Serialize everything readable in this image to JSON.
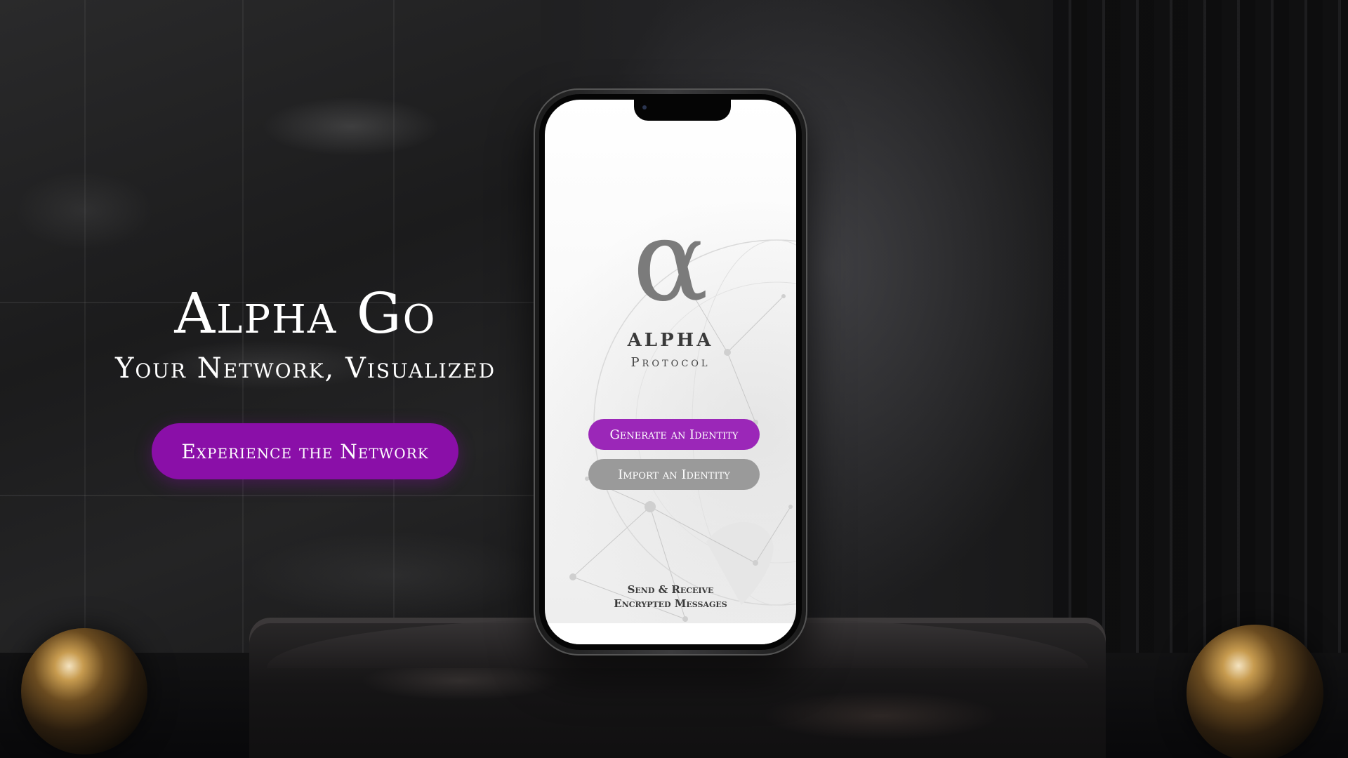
{
  "hero": {
    "title": "Alpha Go",
    "subtitle": "Your Network, Visualized",
    "cta_label": "Experience the Network"
  },
  "phone": {
    "logo_glyph": "α",
    "brand_name": "ALPHA",
    "brand_sub": "Protocol",
    "generate_label": "Generate an Identity",
    "import_label": "Import an Identity",
    "tagline_line1": "Send & Receive",
    "tagline_line2": "Encrypted Messages"
  },
  "colors": {
    "accent_purple": "#8a0fa8",
    "phone_button_purple": "#9b27b8",
    "phone_button_gray": "#9a9a9a",
    "logo_gray": "#7b7b7b",
    "gold": "#c79b4f"
  },
  "icons": {
    "logo": "alpha-logo-icon",
    "background_art": "network-globe-icon"
  }
}
